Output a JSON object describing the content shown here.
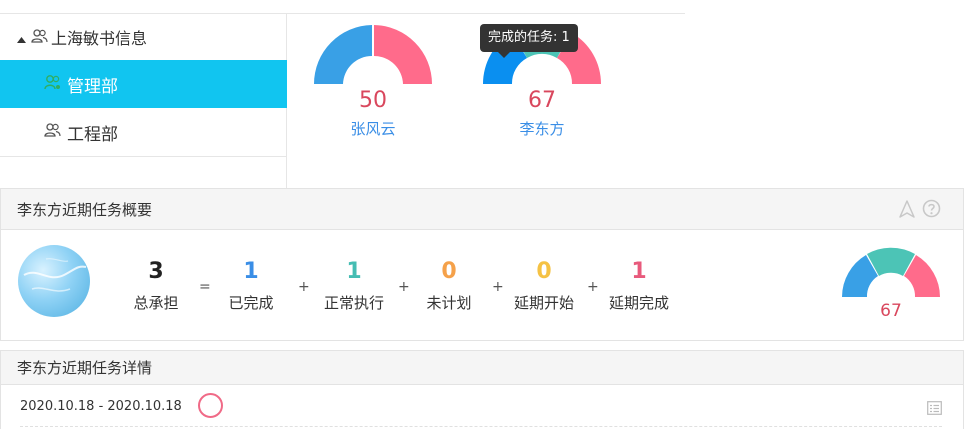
{
  "tree": {
    "root_label": "上海敏书信息",
    "items": [
      {
        "label": "管理部",
        "selected": true
      },
      {
        "label": "工程部",
        "selected": false
      }
    ]
  },
  "gauges": [
    {
      "value": "50",
      "name": "张风云"
    },
    {
      "value": "67",
      "name": "李东方"
    }
  ],
  "tooltip": "完成的任务: 1",
  "summary": {
    "title": "李东方近期任务概要",
    "stats": [
      {
        "num": "3",
        "label": "总承担",
        "color": "#222222"
      },
      {
        "num": "1",
        "label": "已完成",
        "color": "#3a8ee6"
      },
      {
        "num": "1",
        "label": "正常执行",
        "color": "#45bdb3"
      },
      {
        "num": "0",
        "label": "未计划",
        "color": "#f5a14a"
      },
      {
        "num": "0",
        "label": "延期开始",
        "color": "#f5c244"
      },
      {
        "num": "1",
        "label": "延期完成",
        "color": "#e85a7c"
      }
    ],
    "operators": [
      "=",
      "+",
      "+",
      "+",
      "+"
    ],
    "gauge_value": "67"
  },
  "details": {
    "title": "李东方近期任务详情",
    "rows": [
      {
        "date": "2020.10.18 - 2020.10.18"
      }
    ]
  },
  "colors": {
    "selected_bg": "#11c5f0",
    "gauge_blue": "#39a0e6",
    "gauge_pink": "#ff6b8b",
    "gauge_teal": "#4cc4b6",
    "value_red": "#d9475d",
    "name_blue": "#3a8ee6"
  },
  "icons": [
    "triangle-up-icon",
    "users-icon",
    "user-icon",
    "navigate-icon",
    "help-icon",
    "list-icon"
  ]
}
